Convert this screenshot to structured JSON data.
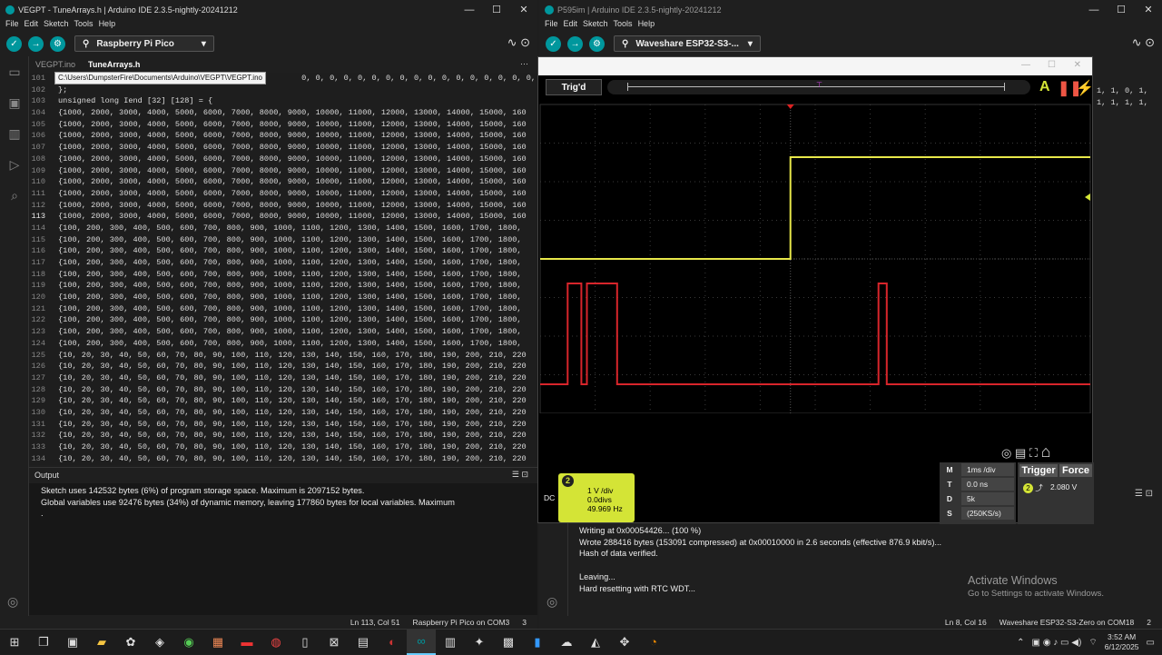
{
  "left": {
    "title": "VEGPT - TuneArrays.h | Arduino IDE 2.3.5-nightly-20241212",
    "menu": [
      "File",
      "Edit",
      "Sketch",
      "Tools",
      "Help"
    ],
    "board": "Raspberry Pi Pico",
    "tabs": [
      "VEGPT.ino",
      "TuneArrays.h"
    ],
    "tooltip": "C:\\Users\\DumpsterFire\\Documents\\Arduino\\VEGPT\\VEGPT.ino",
    "lines": [
      {
        "n": "101",
        "t": "                                                    0, 0, 0, 0, 0, 0, 0, 0, 0, 0, 0, 0, 0, 0, 0, 0, 0, 0, 0, 0, 0"
      },
      {
        "n": "102",
        "t": "};"
      },
      {
        "n": "103",
        "t": "unsigned long Iend [32] [128] = {"
      },
      {
        "n": "104",
        "t": "{1000, 2000, 3000, 4000, 5000, 6000, 7000, 8000, 9000, 10000, 11000, 12000, 13000, 14000, 15000, 160"
      },
      {
        "n": "105",
        "t": "{1000, 2000, 3000, 4000, 5000, 6000, 7000, 8000, 9000, 10000, 11000, 12000, 13000, 14000, 15000, 160"
      },
      {
        "n": "106",
        "t": "{1000, 2000, 3000, 4000, 5000, 6000, 7000, 8000, 9000, 10000, 11000, 12000, 13000, 14000, 15000, 160"
      },
      {
        "n": "107",
        "t": "{1000, 2000, 3000, 4000, 5000, 6000, 7000, 8000, 9000, 10000, 11000, 12000, 13000, 14000, 15000, 160"
      },
      {
        "n": "108",
        "t": "{1000, 2000, 3000, 4000, 5000, 6000, 7000, 8000, 9000, 10000, 11000, 12000, 13000, 14000, 15000, 160"
      },
      {
        "n": "109",
        "t": "{1000, 2000, 3000, 4000, 5000, 6000, 7000, 8000, 9000, 10000, 11000, 12000, 13000, 14000, 15000, 160"
      },
      {
        "n": "110",
        "t": "{1000, 2000, 3000, 4000, 5000, 6000, 7000, 8000, 9000, 10000, 11000, 12000, 13000, 14000, 15000, 160"
      },
      {
        "n": "111",
        "t": "{1000, 2000, 3000, 4000, 5000, 6000, 7000, 8000, 9000, 10000, 11000, 12000, 13000, 14000, 15000, 160"
      },
      {
        "n": "112",
        "t": "{1000, 2000, 3000, 4000, 5000, 6000, 7000, 8000, 9000, 10000, 11000, 12000, 13000, 14000, 15000, 160"
      },
      {
        "n": "113",
        "t": "{1000, 2000, 3000, 4000, 5000, 6000, 7000, 8000, 9000, 10000, 11000, 12000, 13000, 14000, 15000, 160"
      },
      {
        "n": "114",
        "t": "{100, 200, 300, 400, 500, 600, 700, 800, 900, 1000, 1100, 1200, 1300, 1400, 1500, 1600, 1700, 1800,"
      },
      {
        "n": "115",
        "t": "{100, 200, 300, 400, 500, 600, 700, 800, 900, 1000, 1100, 1200, 1300, 1400, 1500, 1600, 1700, 1800,"
      },
      {
        "n": "116",
        "t": "{100, 200, 300, 400, 500, 600, 700, 800, 900, 1000, 1100, 1200, 1300, 1400, 1500, 1600, 1700, 1800,"
      },
      {
        "n": "117",
        "t": "{100, 200, 300, 400, 500, 600, 700, 800, 900, 1000, 1100, 1200, 1300, 1400, 1500, 1600, 1700, 1800,"
      },
      {
        "n": "118",
        "t": "{100, 200, 300, 400, 500, 600, 700, 800, 900, 1000, 1100, 1200, 1300, 1400, 1500, 1600, 1700, 1800,"
      },
      {
        "n": "119",
        "t": "{100, 200, 300, 400, 500, 600, 700, 800, 900, 1000, 1100, 1200, 1300, 1400, 1500, 1600, 1700, 1800,"
      },
      {
        "n": "120",
        "t": "{100, 200, 300, 400, 500, 600, 700, 800, 900, 1000, 1100, 1200, 1300, 1400, 1500, 1600, 1700, 1800,"
      },
      {
        "n": "121",
        "t": "{100, 200, 300, 400, 500, 600, 700, 800, 900, 1000, 1100, 1200, 1300, 1400, 1500, 1600, 1700, 1800,"
      },
      {
        "n": "122",
        "t": "{100, 200, 300, 400, 500, 600, 700, 800, 900, 1000, 1100, 1200, 1300, 1400, 1500, 1600, 1700, 1800,"
      },
      {
        "n": "123",
        "t": "{100, 200, 300, 400, 500, 600, 700, 800, 900, 1000, 1100, 1200, 1300, 1400, 1500, 1600, 1700, 1800,"
      },
      {
        "n": "124",
        "t": "{100, 200, 300, 400, 500, 600, 700, 800, 900, 1000, 1100, 1200, 1300, 1400, 1500, 1600, 1700, 1800,"
      },
      {
        "n": "125",
        "t": "{10, 20, 30, 40, 50, 60, 70, 80, 90, 100, 110, 120, 130, 140, 150, 160, 170, 180, 190, 200, 210, 220"
      },
      {
        "n": "126",
        "t": "{10, 20, 30, 40, 50, 60, 70, 80, 90, 100, 110, 120, 130, 140, 150, 160, 170, 180, 190, 200, 210, 220"
      },
      {
        "n": "127",
        "t": "{10, 20, 30, 40, 50, 60, 70, 80, 90, 100, 110, 120, 130, 140, 150, 160, 170, 180, 190, 200, 210, 220"
      },
      {
        "n": "128",
        "t": "{10, 20, 30, 40, 50, 60, 70, 80, 90, 100, 110, 120, 130, 140, 150, 160, 170, 180, 190, 200, 210, 220"
      },
      {
        "n": "129",
        "t": "{10, 20, 30, 40, 50, 60, 70, 80, 90, 100, 110, 120, 130, 140, 150, 160, 170, 180, 190, 200, 210, 220"
      },
      {
        "n": "130",
        "t": "{10, 20, 30, 40, 50, 60, 70, 80, 90, 100, 110, 120, 130, 140, 150, 160, 170, 180, 190, 200, 210, 220"
      },
      {
        "n": "131",
        "t": "{10, 20, 30, 40, 50, 60, 70, 80, 90, 100, 110, 120, 130, 140, 150, 160, 170, 180, 190, 200, 210, 220"
      },
      {
        "n": "132",
        "t": "{10, 20, 30, 40, 50, 60, 70, 80, 90, 100, 110, 120, 130, 140, 150, 160, 170, 180, 190, 200, 210, 220"
      },
      {
        "n": "133",
        "t": "{10, 20, 30, 40, 50, 60, 70, 80, 90, 100, 110, 120, 130, 140, 150, 160, 170, 180, 190, 200, 210, 220"
      },
      {
        "n": "134",
        "t": "{10, 20, 30, 40, 50, 60, 70, 80, 90, 100, 110, 120, 130, 140, 150, 160, 170, 180, 190, 200, 210, 220"
      }
    ],
    "output_label": "Output",
    "output": "Sketch uses 142532 bytes (6%) of program storage space. Maximum is 2097152 bytes.\nGlobal variables use 92476 bytes (34%) of dynamic memory, leaving 177860 bytes for local variables. Maximum\n.",
    "status_pos": "Ln 113, Col 51",
    "status_board": "Raspberry Pi Pico on COM3",
    "status_count": "3"
  },
  "right": {
    "title": "P595im | Arduino IDE 2.3.5-nightly-20241212",
    "menu": [
      "File",
      "Edit",
      "Sketch",
      "Tools",
      "Help"
    ],
    "board": "Waveshare ESP32-S3-...",
    "side_code": "1, 1, 0, 1, 1,\n1, 1, 1, 1, 1,",
    "output": "Writing at 0x00054426... (100 %)\nWrote 288416 bytes (153091 compressed) at 0x00010000 in 2.6 seconds (effective 876.9 kbit/s)...\nHash of data verified.\n\nLeaving...\nHard resetting with RTC WDT...",
    "status_pos": "Ln 8, Col 16",
    "status_board": "Waveshare ESP32-S3-Zero on COM18",
    "status_count": "2"
  },
  "scope": {
    "trig_label": "Trig'd",
    "channel_num": "2",
    "coupling": "DC",
    "vdiv": "1 V /div",
    "offset": "0.0divs",
    "freq": "49.969 Hz",
    "m_key": "M",
    "m_val": "1ms /div",
    "t_key": "T",
    "t_val": "0.0 ns",
    "d_key": "D",
    "d_val": "5k",
    "s_key": "S",
    "s_val": "(250KS/s)",
    "trigger_label": "Trigger",
    "force_label": "Force",
    "trig_level": "2.080 V",
    "colors": {
      "ch1": "#e8e84a",
      "ch2": "#d8252b"
    },
    "ch1_wave": [
      [
        0,
        0
      ],
      [
        0.455,
        0
      ],
      [
        0.455,
        1
      ],
      [
        1,
        1
      ]
    ],
    "ch2_wave": [
      [
        0,
        0
      ],
      [
        0.05,
        0
      ],
      [
        0.05,
        1
      ],
      [
        0.075,
        1
      ],
      [
        0.075,
        0
      ],
      [
        0.085,
        0
      ],
      [
        0.085,
        1
      ],
      [
        0.14,
        1
      ],
      [
        0.14,
        0
      ],
      [
        0.615,
        0
      ],
      [
        0.615,
        1
      ],
      [
        0.63,
        1
      ],
      [
        0.63,
        0
      ],
      [
        1,
        0
      ]
    ]
  },
  "watermark": {
    "line1": "Activate Windows",
    "line2": "Go to Settings to activate Windows."
  },
  "clock": {
    "time": "3:52 AM",
    "date": "6/12/2025"
  }
}
